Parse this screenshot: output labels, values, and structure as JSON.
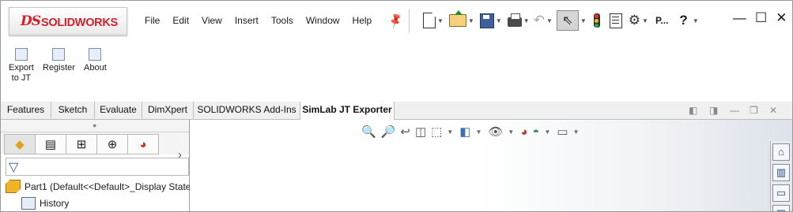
{
  "app": {
    "logo_mark": "DS",
    "logo_text": "SOLIDWORKS"
  },
  "menu": [
    "File",
    "Edit",
    "View",
    "Insert",
    "Tools",
    "Window",
    "Help"
  ],
  "toolbar": {
    "search_short": "P...",
    "help": "?"
  },
  "ribbon": {
    "buttons": [
      {
        "label": "Export\nto JT",
        "icon": "export-jt-icon"
      },
      {
        "label": "Register",
        "icon": "register-icon"
      },
      {
        "label": "About",
        "icon": "about-icon"
      }
    ]
  },
  "tabs": [
    "Features",
    "Sketch",
    "Evaluate",
    "DimXpert",
    "SOLIDWORKS Add-Ins",
    "SimLab JT Exporter"
  ],
  "active_tab": "SimLab JT Exporter",
  "feature_manager": {
    "tree": {
      "part": "Part1  (Default<<Default>_Display State",
      "history": "History"
    }
  },
  "colors": {
    "brand": "#d21f2b",
    "accent": "#2066c4"
  }
}
